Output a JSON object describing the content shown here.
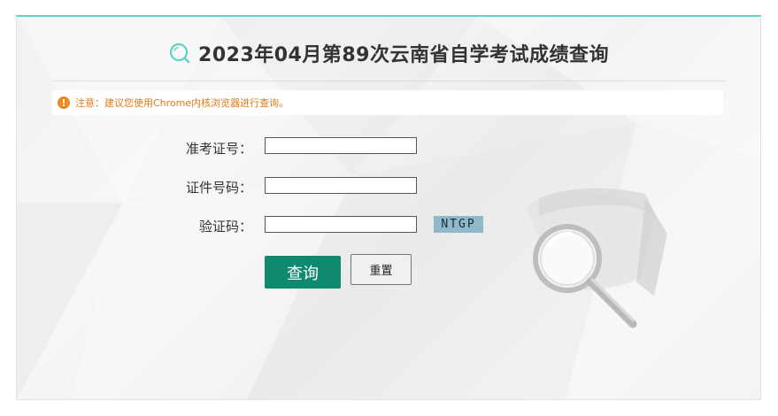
{
  "header": {
    "title": "2023年04月第89次云南省自学考试成绩查询",
    "icon": "search-icon"
  },
  "notice": {
    "icon": "exclamation-icon",
    "text": "注意：建议您使用Chrome内核浏览器进行查询。"
  },
  "form": {
    "exam_number_label": "准考证号：",
    "id_number_label": "证件号码：",
    "captcha_label": "验证码：",
    "captcha_value": "NTGP",
    "exam_number_value": "",
    "id_number_value": "",
    "captcha_input_value": ""
  },
  "buttons": {
    "query_label": "查询",
    "reset_label": "重置"
  },
  "colors": {
    "accent_top_border": "#5fd3c9",
    "query_button": "#0f8a6e",
    "notice_text": "#e07a16",
    "notice_icon": "#f08a24",
    "captcha_bg": "#8fb8c8"
  }
}
